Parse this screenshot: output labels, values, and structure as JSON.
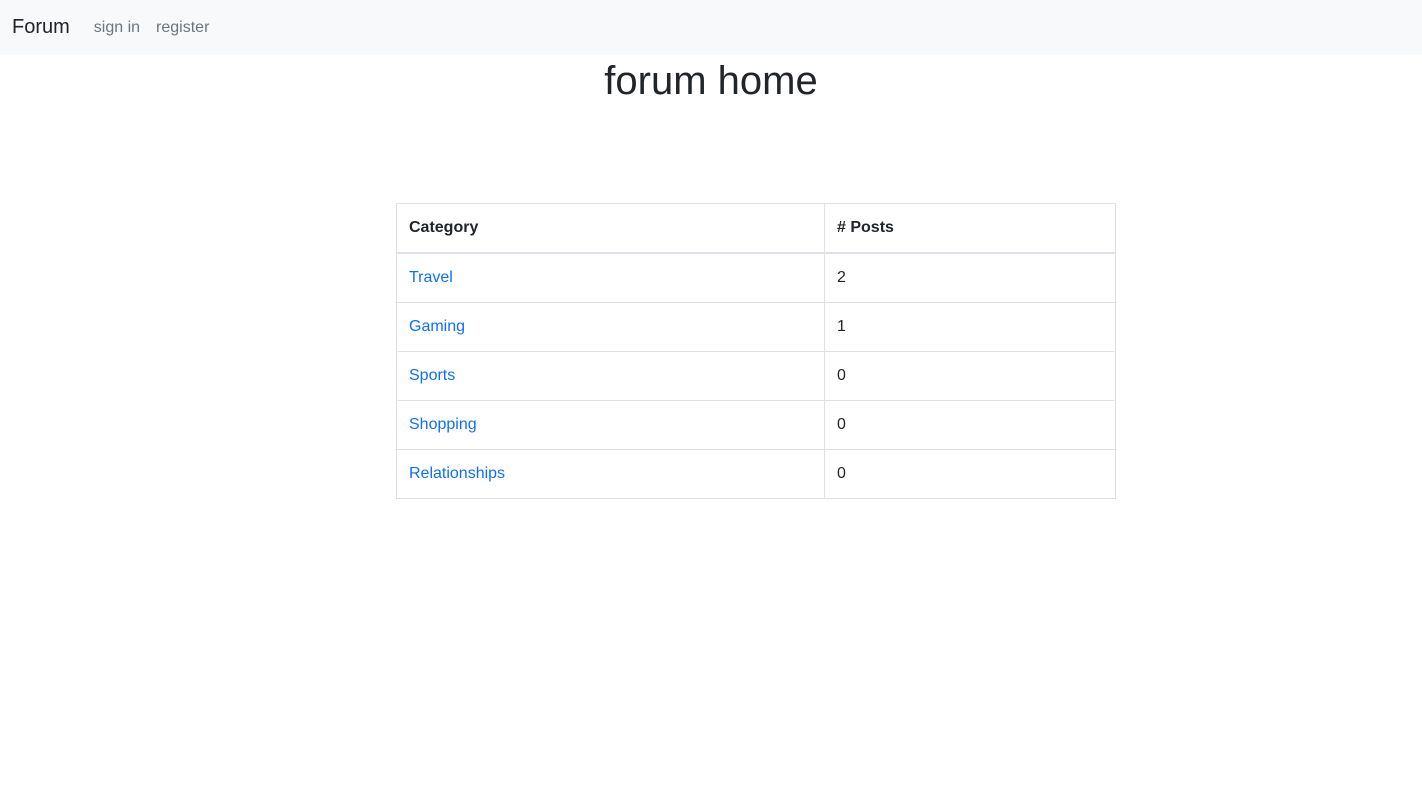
{
  "navbar": {
    "brand": "Forum",
    "links": [
      {
        "label": "sign in"
      },
      {
        "label": "register"
      }
    ]
  },
  "main": {
    "title": "forum home"
  },
  "table": {
    "headers": [
      "Category",
      "# Posts"
    ],
    "rows": [
      {
        "category": "Travel",
        "posts": "2"
      },
      {
        "category": "Gaming",
        "posts": "1"
      },
      {
        "category": "Sports",
        "posts": "0"
      },
      {
        "category": "Shopping",
        "posts": "0"
      },
      {
        "category": "Relationships",
        "posts": "0"
      }
    ]
  },
  "colors": {
    "navbar_bg": "#f8f9fa",
    "link": "#0d6efd",
    "muted_link": "#6c757d",
    "text": "#212529",
    "border": "#dee2e6"
  }
}
